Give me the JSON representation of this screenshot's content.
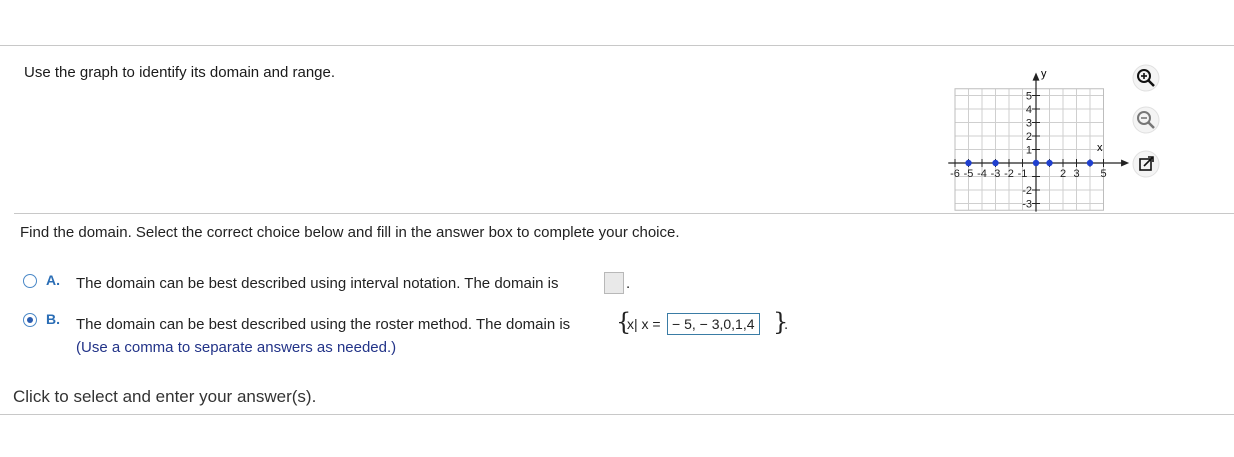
{
  "question": {
    "prompt": "Use the graph to identify its domain and range.",
    "instruction": "Find the domain. Select the correct choice below and fill in the answer box to complete your choice."
  },
  "graph": {
    "x_axis_label": "x",
    "y_axis_label": "y",
    "x_tick_labels": [
      "-6",
      "-5",
      "-4",
      "-3",
      "-2",
      "-1",
      "2",
      "3",
      "5"
    ],
    "y_tick_labels": [
      "5",
      "4",
      "3",
      "2",
      "1",
      "-2",
      "-3"
    ],
    "points_x": [
      -5,
      -3,
      0,
      1,
      4
    ],
    "point_color": "#1f3fcf"
  },
  "choices": [
    {
      "letter": "A.",
      "selected": false,
      "text": "The domain can be best described using interval notation. The domain is",
      "answer": "",
      "suffix": "."
    },
    {
      "letter": "B.",
      "selected": true,
      "text": "The domain can be best described using the roster method. The domain is",
      "set_open": "{",
      "set_prefix": "x| x =",
      "answer": "− 5, − 3,0,1,4",
      "set_close": "}",
      "suffix": ".",
      "hint": "(Use a comma to separate answers as needed.)"
    }
  ],
  "footer": "Click to select and enter your answer(s).",
  "tools": {
    "zoom_in": "zoom-in-icon",
    "zoom_out": "zoom-out-icon",
    "popout": "popout-icon"
  },
  "colors": {
    "accent": "#2a6db5",
    "answer_border": "#3a7ca5"
  }
}
